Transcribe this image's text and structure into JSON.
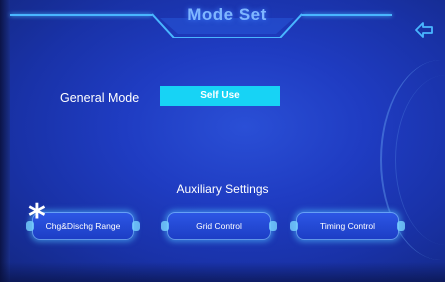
{
  "header": {
    "title": "Mode Set"
  },
  "general": {
    "label": "General Mode",
    "value": "Self Use"
  },
  "auxiliary": {
    "title": "Auxiliary Settings",
    "buttons": [
      {
        "label": "Chg&Dischg Range"
      },
      {
        "label": "Grid Control"
      },
      {
        "label": "Timing Control"
      }
    ]
  },
  "colors": {
    "background": "#1f3cc2",
    "accent": "#17d3f5",
    "glow": "#49b6ff"
  },
  "icons": {
    "back": "back-arrow-icon"
  },
  "overlay": {
    "marker": "*"
  }
}
